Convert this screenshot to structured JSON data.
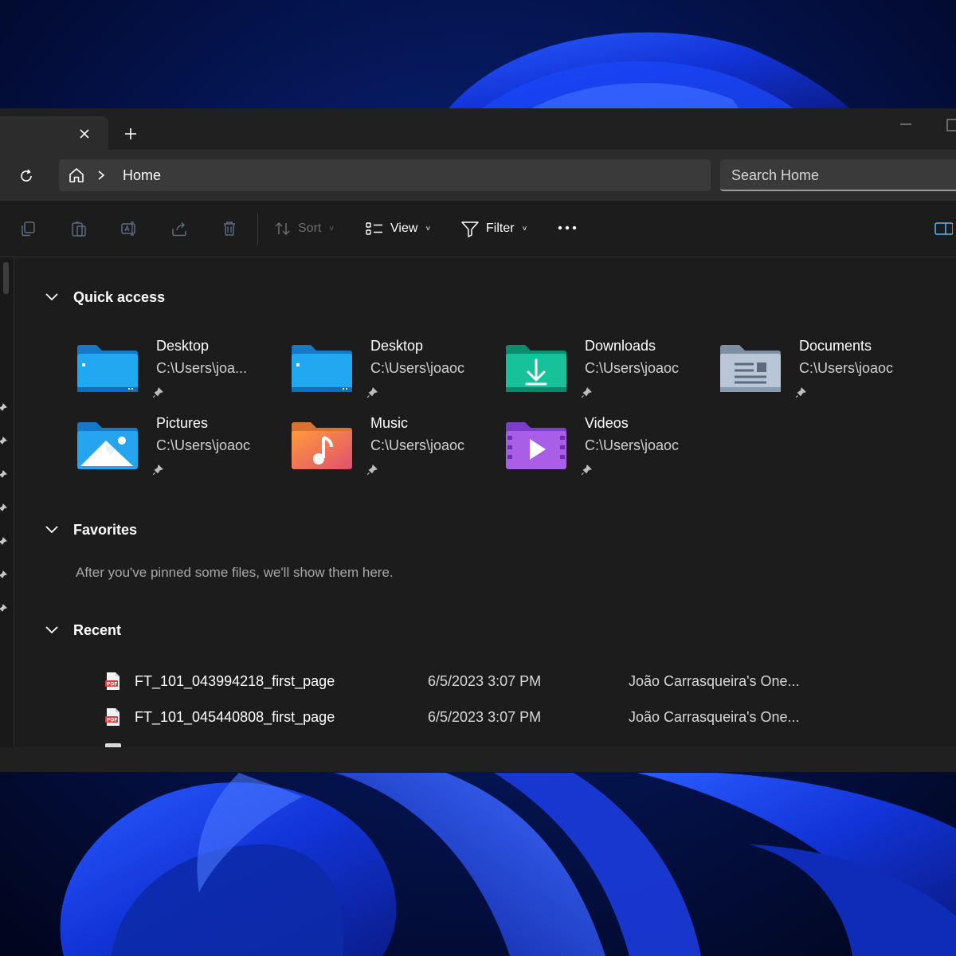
{
  "tabs": {
    "close_symbol": "×",
    "new_tab_symbol": "+"
  },
  "address": {
    "path": "Home",
    "search_placeholder": "Search Home"
  },
  "command_bar": {
    "sort_label": "Sort",
    "view_label": "View",
    "filter_label": "Filter",
    "more_label": "•••"
  },
  "quick_access": {
    "title": "Quick access",
    "items": [
      {
        "name": "Desktop",
        "path": "C:\\Users\\joa...",
        "icon": "desktop-folder-icon"
      },
      {
        "name": "Desktop",
        "path": "C:\\Users\\joaoc",
        "icon": "desktop-folder-icon"
      },
      {
        "name": "Downloads",
        "path": "C:\\Users\\joaoc",
        "icon": "downloads-folder-icon"
      },
      {
        "name": "Documents",
        "path": "C:\\Users\\joaoc",
        "icon": "documents-folder-icon"
      },
      {
        "name": "Pictures",
        "path": "C:\\Users\\joaoc",
        "icon": "pictures-folder-icon"
      },
      {
        "name": "Music",
        "path": "C:\\Users\\joaoc",
        "icon": "music-folder-icon"
      },
      {
        "name": "Videos",
        "path": "C:\\Users\\joaoc",
        "icon": "videos-folder-icon"
      }
    ]
  },
  "favorites": {
    "title": "Favorites",
    "empty_text": "After you've pinned some files, we'll show them here."
  },
  "recent": {
    "title": "Recent",
    "rows": [
      {
        "name": "FT_101_043994218_first_page",
        "date": "6/5/2023 3:07 PM",
        "location": "João Carrasqueira's One..."
      },
      {
        "name": "FT_101_045440808_first_page",
        "date": "6/5/2023 3:07 PM",
        "location": "João Carrasqueira's One..."
      }
    ]
  },
  "colors": {
    "window_bg": "#1c1c1c",
    "address_bg": "#2c2c2c",
    "accent_blue": "#1e90d6",
    "wallpaper_blue": "#1a3ff0",
    "pdf_red": "#e23b3b"
  }
}
